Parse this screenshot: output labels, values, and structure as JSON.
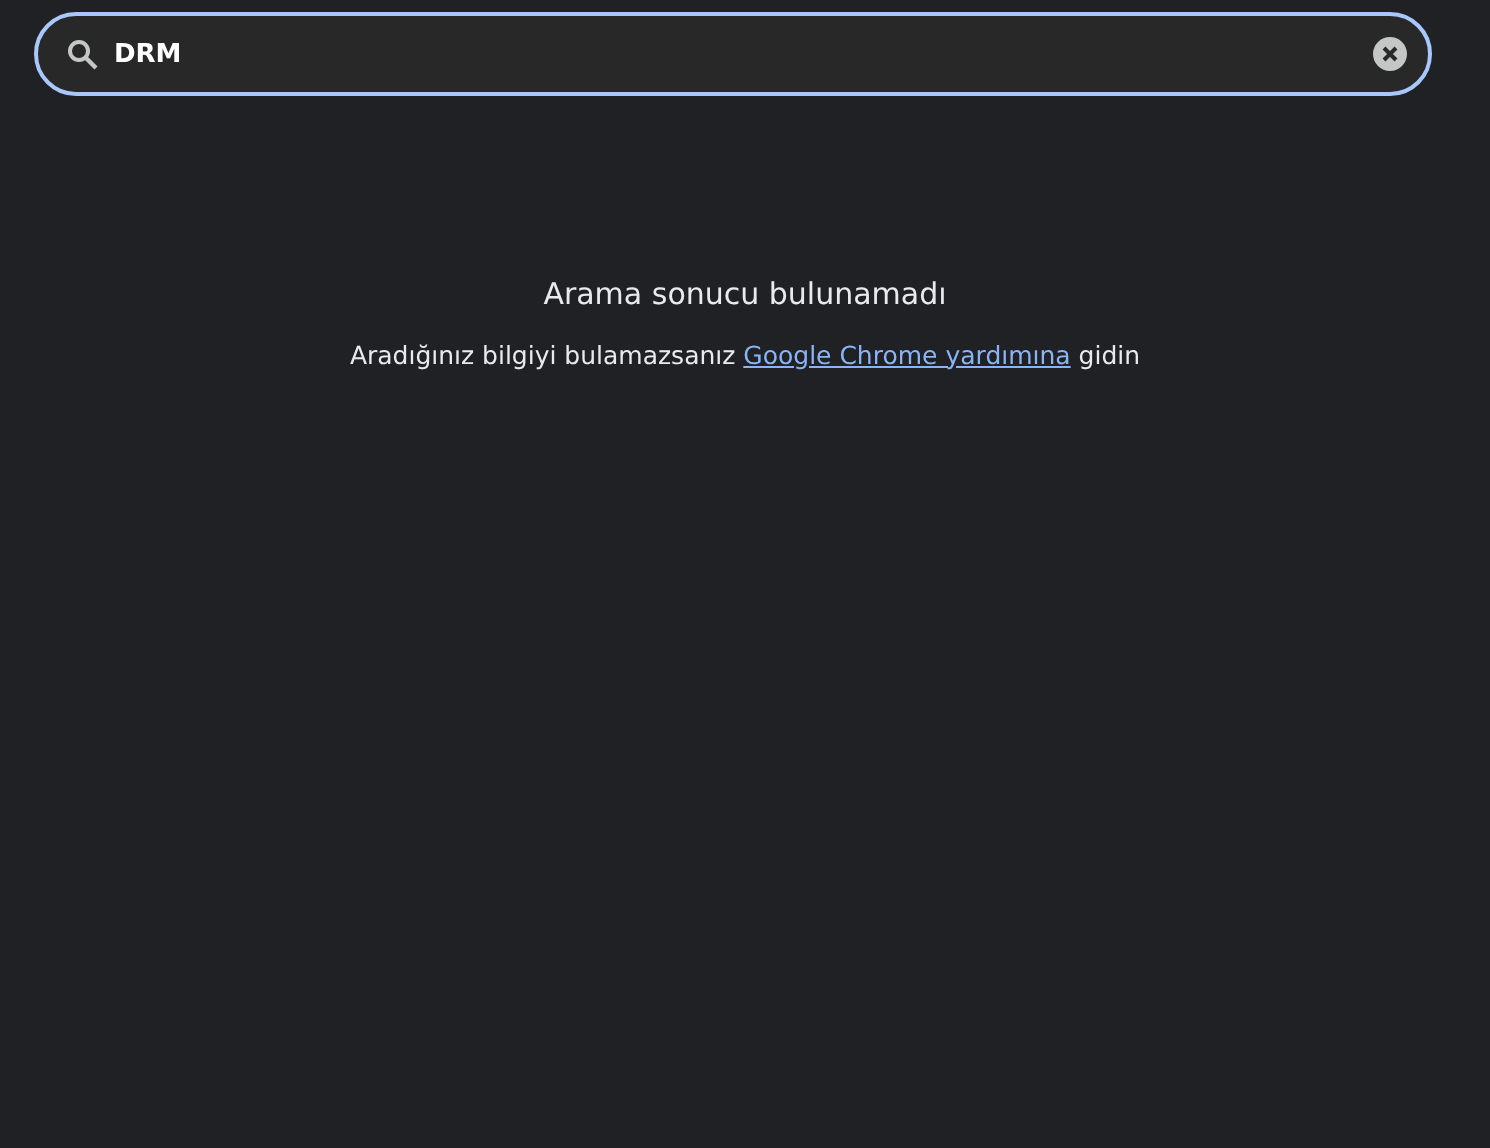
{
  "search": {
    "value": "DRM"
  },
  "empty_state": {
    "title": "Arama sonucu bulunamadı",
    "message_before": "Aradığınız bilgiyi bulamazsanız",
    "link": "Google Chrome yardımına",
    "message_after": "gidin"
  }
}
